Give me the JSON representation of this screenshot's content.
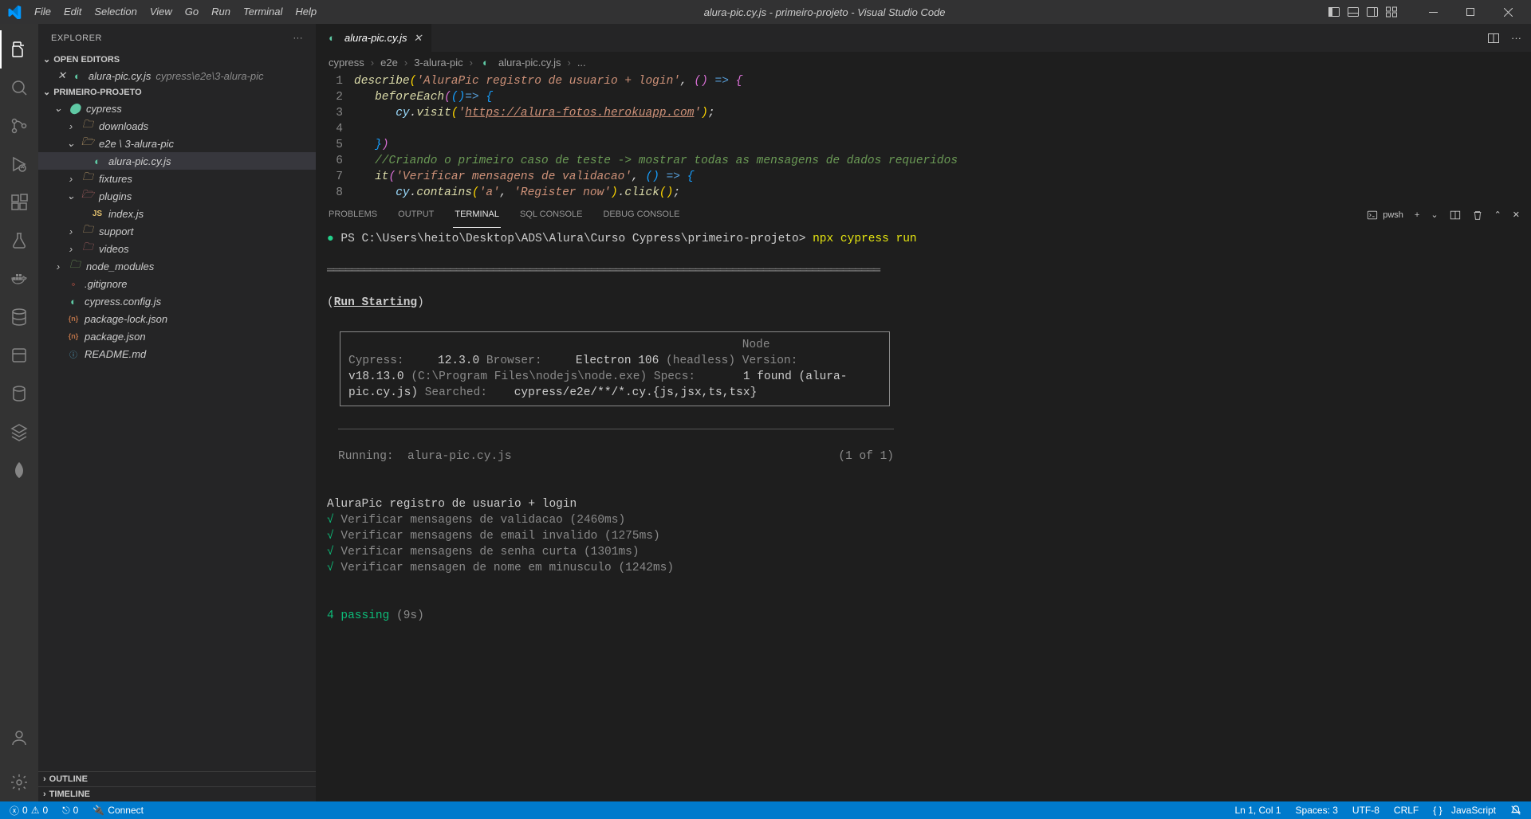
{
  "window": {
    "title": "alura-pic.cy.js - primeiro-projeto - Visual Studio Code"
  },
  "menu": {
    "file": "File",
    "edit": "Edit",
    "selection": "Selection",
    "view": "View",
    "go": "Go",
    "run": "Run",
    "terminal": "Terminal",
    "help": "Help"
  },
  "sidebar": {
    "title": "EXPLORER",
    "openEditors": "OPEN EDITORS",
    "openEditorFile": "alura-pic.cy.js",
    "openEditorPath": "cypress\\e2e\\3-alura-pic",
    "project": "PRIMEIRO-PROJETO",
    "tree": {
      "cypress": "cypress",
      "downloads": "downloads",
      "e2e": "e2e \\ 3-alura-pic",
      "file_alura": "alura-pic.cy.js",
      "fixtures": "fixtures",
      "plugins": "plugins",
      "indexjs": "index.js",
      "support": "support",
      "videos": "videos",
      "node_modules": "node_modules",
      "gitignore": ".gitignore",
      "cypressconfig": "cypress.config.js",
      "packagelock": "package-lock.json",
      "packagejson": "package.json",
      "readme": "README.md"
    },
    "outline": "OUTLINE",
    "timeline": "TIMELINE"
  },
  "editor": {
    "tabName": "alura-pic.cy.js",
    "crumbs": {
      "c1": "cypress",
      "c2": "e2e",
      "c3": "3-alura-pic",
      "c4": "alura-pic.cy.js",
      "c5": "..."
    },
    "lines": {
      "l1a": "describe",
      "l1b": "(",
      "l1c": "'AluraPic registro de usuario + login'",
      "l1d": ", ",
      "l1e": "()",
      "l1f": " => ",
      "l1g": "{",
      "l2a": "beforeEach",
      "l2b": "(",
      "l2c": "(",
      "l2d": ")",
      "l2e": "=> ",
      "l2f": "{",
      "l3a": "cy",
      "l3b": ".",
      "l3c": "visit",
      "l3d": "(",
      "l3e": "'",
      "l3u": "https://alura-fotos.herokuapp.com",
      "l3f": "'",
      "l3g": ")",
      "l3h": ";",
      "l5a": "}",
      "l5b": ")",
      "l6": "//Criando o primeiro caso de teste -> mostrar todas as mensagens de dados requeridos",
      "l7a": "it",
      "l7b": "(",
      "l7c": "'Verificar mensagens de validacao'",
      "l7d": ", ",
      "l7e": "()",
      "l7f": " => ",
      "l7g": "{",
      "l8a": "cy",
      "l8b": ".",
      "l8c": "contains",
      "l8d": "(",
      "l8e": "'a'",
      "l8f": ", ",
      "l8g": "'Register now'",
      "l8h": ")",
      "l8i": ".",
      "l8j": "click",
      "l8k": "(",
      "l8l": ")",
      "l8m": ";"
    }
  },
  "panel": {
    "problems": "PROBLEMS",
    "output": "OUTPUT",
    "terminal": "TERMINAL",
    "sql": "SQL CONSOLE",
    "debug": "DEBUG CONSOLE",
    "shell": "pwsh"
  },
  "terminal": {
    "prompt": "PS C:\\Users\\heito\\Desktop\\ADS\\Alura\\Curso Cypress\\primeiro-projeto>",
    "cmd": "npx cypress run",
    "runstarting": "Run Starting",
    "box": {
      "cypressL": "Cypress:",
      "cypressV": "12.3.0",
      "browserL": "Browser:",
      "browserV": "Electron 106",
      "browserH": "(headless)",
      "nodeL": "Node Version:",
      "nodeV": "v18.13.0",
      "nodeH": "(C:\\Program Files\\nodejs\\node.exe)",
      "specsL": "Specs:",
      "specsV": "1 found (alura-pic.cy.js)",
      "searchedL": "Searched:",
      "searchedV": "cypress/e2e/**/*.cy.{js,jsx,ts,tsx}"
    },
    "runningL": "Running:",
    "runningV": "alura-pic.cy.js",
    "runningC": "(1 of 1)",
    "suite": "AluraPic registro de usuario + login",
    "t1": "Verificar mensagens de validacao (2460ms)",
    "t2": "Verificar mensagens de email invalido (1275ms)",
    "t3": "Verificar mensagens de senha curta (1301ms)",
    "t4": "Verificar mensagen de nome em minusculo (1242ms)",
    "passing": "4 passing",
    "passingT": "(9s)"
  },
  "status": {
    "errors": "0",
    "warnings": "0",
    "ports": "0",
    "connect": "Connect",
    "ln": "Ln 1, Col 1",
    "spaces": "Spaces: 3",
    "enc": "UTF-8",
    "eol": "CRLF",
    "lang": "JavaScript"
  }
}
